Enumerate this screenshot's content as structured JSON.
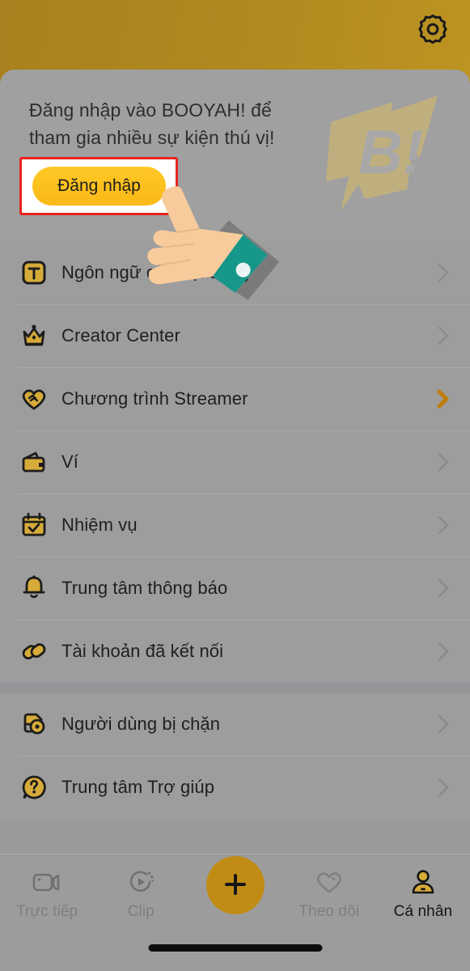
{
  "header": {
    "settings_icon": "gear-icon"
  },
  "login_card": {
    "prompt_line1": "Đăng nhập vào BOOYAH! để",
    "prompt_line2": "tham gia nhiều sự kiện thú vị!",
    "login_button_label": "Đăng nhập",
    "logo_text": "B!",
    "annotation": "red-highlight-box"
  },
  "menu": {
    "group1": [
      {
        "label": "Ngôn ngữ của nội dung",
        "icon": "translate-icon",
        "chevron": "gray"
      },
      {
        "label": "Creator Center",
        "icon": "crown-icon",
        "chevron": "gray"
      },
      {
        "label": "Chương trình Streamer",
        "icon": "heart-handshake-icon",
        "chevron": "gold"
      },
      {
        "label": "Ví",
        "icon": "wallet-icon",
        "chevron": "gray"
      },
      {
        "label": "Nhiệm vụ",
        "icon": "calendar-check-icon",
        "chevron": "gray"
      },
      {
        "label": "Trung tâm thông báo",
        "icon": "bell-icon",
        "chevron": "gray"
      },
      {
        "label": "Tài khoản đã kết nối",
        "icon": "link-icon",
        "chevron": "gray"
      }
    ],
    "group2": [
      {
        "label": "Người dùng bị chặn",
        "icon": "blocked-user-icon",
        "chevron": "gray"
      },
      {
        "label": "Trung tâm Trợ giúp",
        "icon": "help-circle-icon",
        "chevron": "gray"
      }
    ]
  },
  "bottom_nav": {
    "items": [
      {
        "label": "Trực tiếp",
        "icon": "video-camera-icon",
        "active": false
      },
      {
        "label": "Clip",
        "icon": "clip-play-icon",
        "active": false
      },
      {
        "label": "",
        "icon": "plus-icon",
        "active": false
      },
      {
        "label": "Theo dõi",
        "icon": "heart-icon",
        "active": false
      },
      {
        "label": "Cá nhân",
        "icon": "person-icon",
        "active": true
      }
    ]
  },
  "colors": {
    "header_gold": "#a8801d",
    "accent_gold": "#c08c16",
    "button_yellow": "#f9b916",
    "annotation_red": "#e8241f",
    "icon_gold": "#d6ab3a",
    "dim_overlay": "#9d9d9d",
    "sleeve_teal": "#179b8c"
  }
}
